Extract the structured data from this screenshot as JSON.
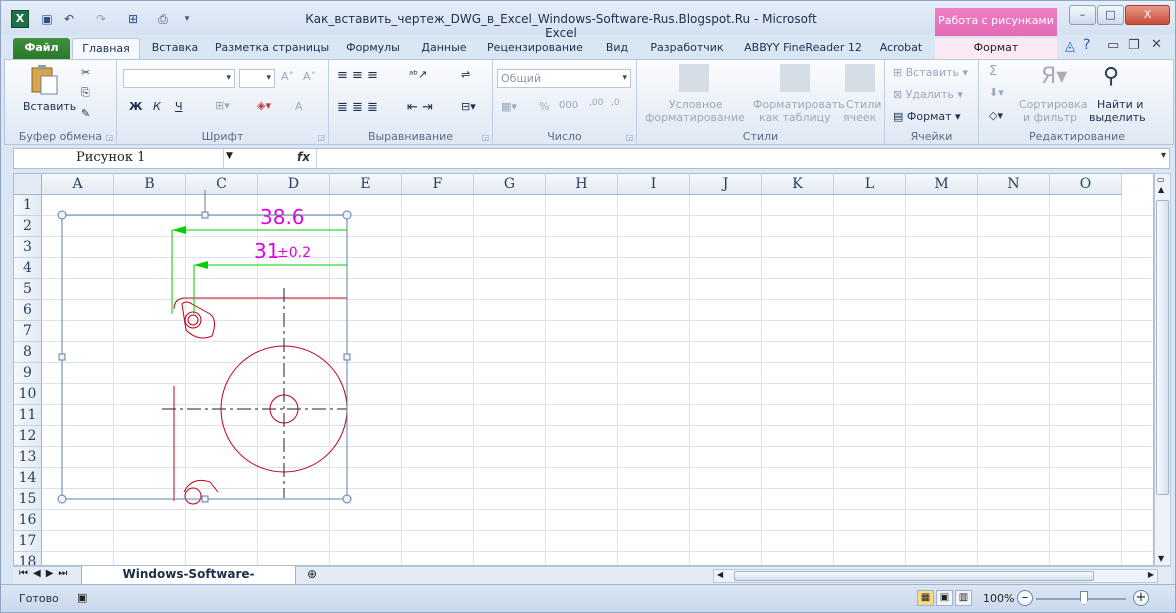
{
  "window": {
    "title": "Как_вставить_чертеж_DWG_в_Excel_Windows-Software-Rus.Blogspot.Ru  -  Microsoft Excel",
    "context_tab": "Работа с рисунками",
    "min": "–",
    "max": "□",
    "close": "X"
  },
  "tabs": [
    "Файл",
    "Главная",
    "Вставка",
    "Разметка страницы",
    "Формулы",
    "Данные",
    "Рецензирование",
    "Вид",
    "Разработчик",
    "ABBYY FineReader 12",
    "Acrobat",
    "Формат"
  ],
  "ribbon": {
    "clipboard": {
      "paste": "Вставить",
      "label": "Буфер обмена"
    },
    "font": {
      "bold": "Ж",
      "italic": "К",
      "underline": "Ч",
      "grow": "A˄",
      "shrink": "A˅",
      "color": "A",
      "label": "Шрифт"
    },
    "alignment": {
      "label": "Выравнивание"
    },
    "number": {
      "format": "Общий",
      "percent": "%",
      "thousands": "000",
      "inc": ",00",
      "dec": ",0",
      "label": "Число"
    },
    "styles": {
      "cond": "Условное",
      "cond2": "форматирование",
      "table": "Форматировать",
      "table2": "как таблицу",
      "cell": "Стили",
      "cell2": "ячеек",
      "label": "Стили"
    },
    "cells": {
      "insert": "Вставить",
      "delete": "Удалить",
      "format": "Формат",
      "label": "Ячейки"
    },
    "editing": {
      "sum": "Σ",
      "sort": "Сортировка",
      "sort2": "и фильтр",
      "find": "Найти и",
      "find2": "выделить",
      "label": "Редактирование"
    }
  },
  "formula_bar": {
    "name_box": "Рисунок 1",
    "fx": "fx",
    "formula": ""
  },
  "columns": [
    "A",
    "B",
    "C",
    "D",
    "E",
    "F",
    "G",
    "H",
    "I",
    "J",
    "K",
    "L",
    "M",
    "N",
    "O"
  ],
  "rows": [
    "1",
    "2",
    "3",
    "4",
    "5",
    "6",
    "7",
    "8",
    "9",
    "10",
    "11",
    "12",
    "13",
    "14",
    "15",
    "16",
    "17",
    "18"
  ],
  "drawing": {
    "dim1": "38.6",
    "dim2": "31",
    "dim2_tol": "±0.2",
    "line_color": "#c0001a",
    "dim_color": "#00d000",
    "text_color": "#e000e0"
  },
  "sheet": {
    "tab": "Windows-Software-RUS.Blogspot"
  },
  "status": {
    "ready": "Готово",
    "zoom": "100%"
  }
}
